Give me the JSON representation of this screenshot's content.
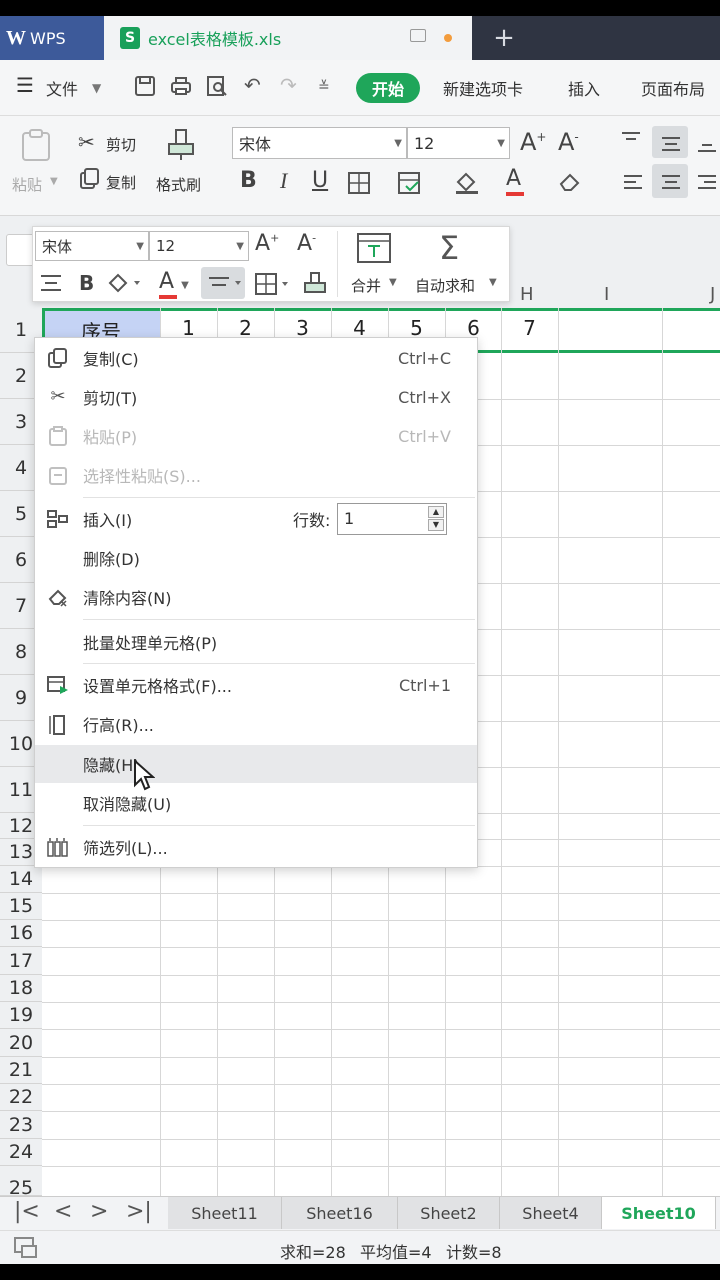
{
  "titlebar": {
    "app_name": "WPS",
    "app_logo": "W",
    "file_name": "excel表格模板.xls",
    "file_icon_letter": "S",
    "new_tab": "+"
  },
  "menubar": {
    "file_menu": "文件",
    "items": [
      "开始",
      "新建选项卡",
      "插入",
      "页面布局"
    ]
  },
  "ribbon": {
    "paste": "粘贴",
    "cut": "剪切",
    "copy": "复制",
    "format_painter": "格式刷",
    "font_name": "宋体",
    "font_size": "12",
    "bold": "B",
    "italic": "I",
    "underline": "U",
    "font_color_letter": "A"
  },
  "mini_toolbar": {
    "font_name": "宋体",
    "font_size": "12",
    "bold": "B",
    "merge": "合并",
    "autosum": "自动求和"
  },
  "grid": {
    "col_headers_visible": [
      "H",
      "I",
      "J"
    ],
    "row1": [
      "序号",
      "1",
      "2",
      "3",
      "4",
      "5",
      "6",
      "7"
    ],
    "row_numbers": [
      "1",
      "2",
      "3",
      "4",
      "5",
      "6",
      "7",
      "8",
      "9",
      "10",
      "11",
      "12",
      "13",
      "14",
      "15",
      "16",
      "17",
      "18",
      "19",
      "20",
      "21",
      "22",
      "23",
      "24",
      "25"
    ]
  },
  "context_menu": {
    "items": [
      {
        "label": "复制(C)",
        "shortcut": "Ctrl+C",
        "icon": "copy-icon",
        "enabled": true
      },
      {
        "label": "剪切(T)",
        "shortcut": "Ctrl+X",
        "icon": "scissors-icon",
        "enabled": true
      },
      {
        "label": "粘贴(P)",
        "shortcut": "Ctrl+V",
        "icon": "clipboard-icon",
        "enabled": false
      },
      {
        "label": "选择性粘贴(S)...",
        "shortcut": "",
        "icon": "clipboard-special-icon",
        "enabled": false
      },
      {
        "label": "插入(I)",
        "shortcut": "",
        "icon": "insert-rows-icon",
        "enabled": true
      },
      {
        "label": "删除(D)",
        "shortcut": "",
        "icon": "",
        "enabled": true
      },
      {
        "label": "清除内容(N)",
        "shortcut": "",
        "icon": "eraser-icon",
        "enabled": true
      },
      {
        "label": "批量处理单元格(P)",
        "shortcut": "",
        "icon": "",
        "enabled": true
      },
      {
        "label": "设置单元格格式(F)...",
        "shortcut": "Ctrl+1",
        "icon": "format-cells-icon",
        "enabled": true
      },
      {
        "label": "行高(R)...",
        "shortcut": "",
        "icon": "row-height-icon",
        "enabled": true
      },
      {
        "label": "隐藏(H)",
        "shortcut": "",
        "icon": "",
        "enabled": true
      },
      {
        "label": "取消隐藏(U)",
        "shortcut": "",
        "icon": "",
        "enabled": true
      },
      {
        "label": "筛选列(L)...",
        "shortcut": "",
        "icon": "filter-columns-icon",
        "enabled": true
      }
    ],
    "row_count_label": "行数:",
    "row_count_value": "1"
  },
  "sheets": {
    "tabs": [
      "Sheet11",
      "Sheet16",
      "Sheet2",
      "Sheet4",
      "Sheet10"
    ],
    "active": "Sheet10"
  },
  "statusbar": {
    "sum": "求和=28",
    "average": "平均值=4",
    "count": "计数=8"
  },
  "colors": {
    "accent": "#1fa65a",
    "tabbar": "#2f3442",
    "wps_blue": "#3d5a9a",
    "selection": "#c5d3f5"
  }
}
